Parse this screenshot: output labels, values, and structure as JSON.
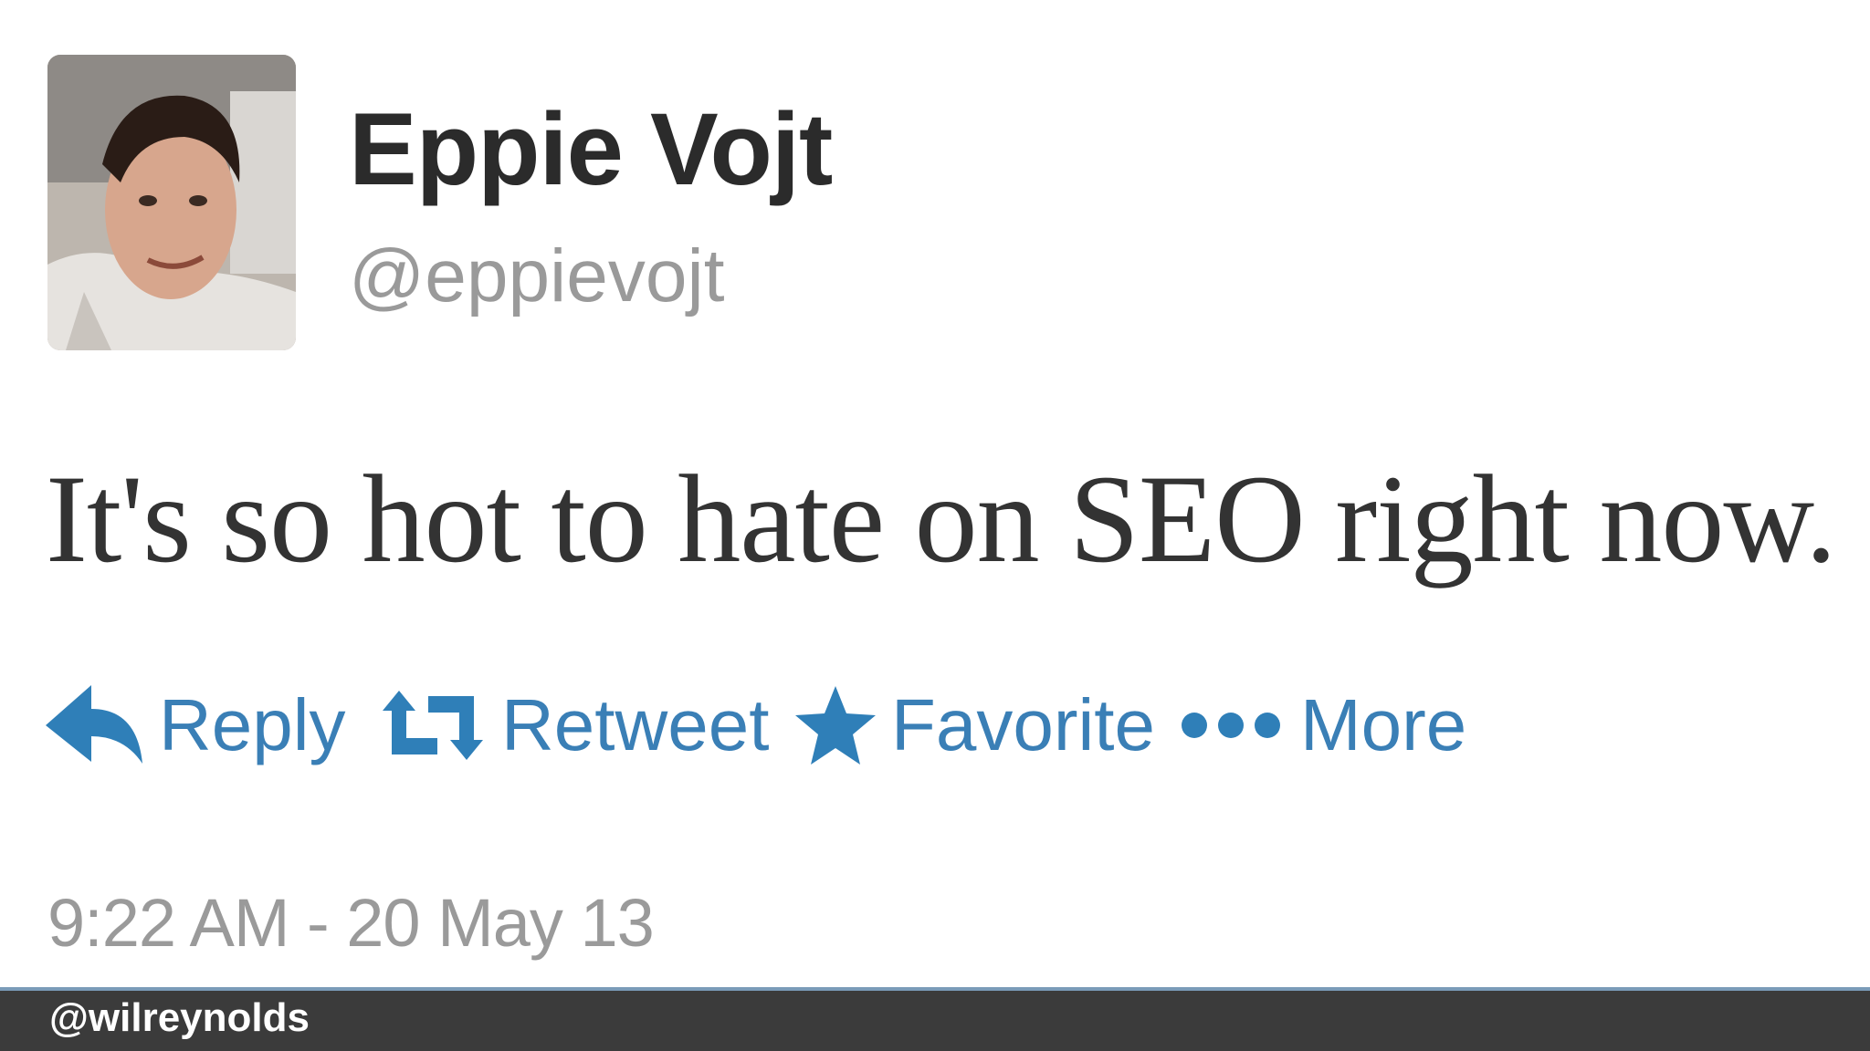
{
  "tweet": {
    "display_name": "Eppie Vojt",
    "handle": "@eppievojt",
    "text": "It's so hot to hate on SEO right now.",
    "timestamp": "9:22 AM - 20 May 13"
  },
  "actions": {
    "reply_label": "Reply",
    "retweet_label": "Retweet",
    "favorite_label": "Favorite",
    "more_label": "More",
    "reply_icon": "reply-arrow-icon",
    "retweet_icon": "retweet-icon",
    "favorite_icon": "star-icon",
    "more_icon": "ellipsis-icon"
  },
  "footer": {
    "handle": "@wilreynolds"
  },
  "colors": {
    "action_blue": "#3a7fb6",
    "footer_bg": "#3b3b3b",
    "footer_accent": "#7a9bb8"
  }
}
